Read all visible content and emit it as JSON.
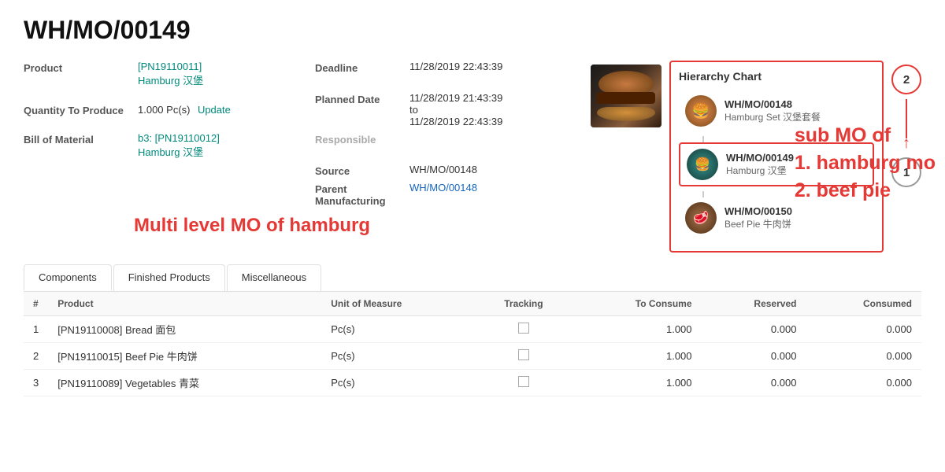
{
  "page": {
    "title": "WH/MO/00149"
  },
  "fields": {
    "product_label": "Product",
    "product_code": "[PN19110011]",
    "product_name": "Hamburg 汉堡",
    "qty_label": "Quantity To Produce",
    "qty_value": "1.000 Pc(s)",
    "update_label": "Update",
    "bom_label": "Bill of Material",
    "bom_value": "b3: [PN19110012]",
    "bom_name": "Hamburg 汉堡",
    "deadline_label": "Deadline",
    "deadline_value": "11/28/2019 22:43:39",
    "planned_date_label": "Planned Date",
    "planned_date_from": "11/28/2019 21:43:39",
    "planned_date_to_label": "to",
    "planned_date_to": "11/28/2019 22:43:39",
    "responsible_label": "Responsible",
    "source_label": "Source",
    "source_value": "WH/MO/00148",
    "parent_mfg_label": "Parent Manufacturing",
    "parent_mfg_value": "WH/MO/00148"
  },
  "hierarchy": {
    "title": "Hierarchy Chart",
    "items": [
      {
        "code": "WH/MO/00148",
        "name": "Hamburg Set 汉堡套餐",
        "avatar": "burger-set"
      },
      {
        "code": "WH/MO/00149",
        "name": "Hamburg 汉堡",
        "avatar": "hamburg",
        "active": true
      },
      {
        "code": "WH/MO/00150",
        "name": "Beef Pie 牛肉饼",
        "avatar": "beef-pie"
      }
    ],
    "badge_2": "2",
    "badge_1": "1"
  },
  "annotations": {
    "multi_level": "Multi level MO of  hamburg",
    "sub_mo_line1": "sub MO of",
    "sub_mo_line2": "1. hamburg mo",
    "sub_mo_line3": "2. beef pie"
  },
  "tabs": [
    {
      "id": "components",
      "label": "Components",
      "active": true
    },
    {
      "id": "finished-products",
      "label": "Finished Products"
    },
    {
      "id": "miscellaneous",
      "label": "Miscellaneous"
    }
  ],
  "table": {
    "columns": [
      {
        "id": "num",
        "label": "#"
      },
      {
        "id": "product",
        "label": "Product"
      },
      {
        "id": "uom",
        "label": "Unit of Measure"
      },
      {
        "id": "tracking",
        "label": "Tracking"
      },
      {
        "id": "to_consume",
        "label": "To Consume"
      },
      {
        "id": "reserved",
        "label": "Reserved"
      },
      {
        "id": "consumed",
        "label": "Consumed"
      }
    ],
    "rows": [
      {
        "num": "1",
        "product": "[PN19110008] Bread 面包",
        "uom": "Pc(s)",
        "tracking": false,
        "to_consume": "1.000",
        "reserved": "0.000",
        "consumed": "0.000"
      },
      {
        "num": "2",
        "product": "[PN19110015] Beef Pie 牛肉饼",
        "uom": "Pc(s)",
        "tracking": false,
        "to_consume": "1.000",
        "reserved": "0.000",
        "consumed": "0.000"
      },
      {
        "num": "3",
        "product": "[PN19110089] Vegetables 青菜",
        "uom": "Pc(s)",
        "tracking": false,
        "to_consume": "1.000",
        "reserved": "0.000",
        "consumed": "0.000"
      }
    ]
  }
}
